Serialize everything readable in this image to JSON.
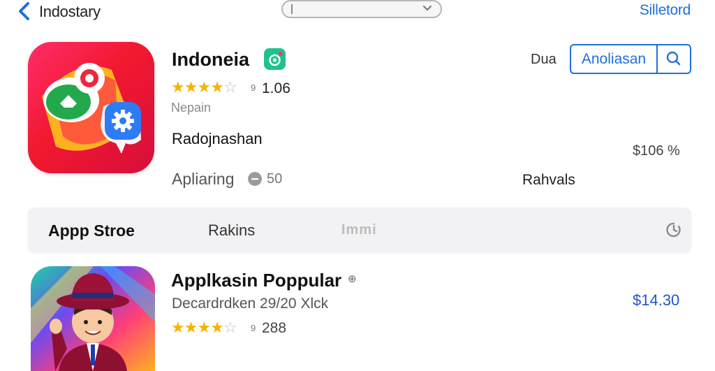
{
  "nav": {
    "back_label": "Indostary",
    "select_label": "Silletord"
  },
  "featured": {
    "title": "Indoneia",
    "rating_stars": 3.5,
    "rating_separator": "9",
    "rating_value": "1.06",
    "subtitle": "Nepain",
    "description": "Radojnashan",
    "info_label": "Apliaring",
    "info_value": "50",
    "side_label": "Dua",
    "get_button": "Anoliasan",
    "price": "$106 %",
    "reviews": "Rahvals",
    "colors": {
      "icon_bg": "#f2182f",
      "badge": "#1ec38c"
    }
  },
  "tabs": [
    {
      "label": "Appp Stroe",
      "selected": true
    },
    {
      "label": "Rakins",
      "selected": false
    },
    {
      "label": "Immi",
      "selected": false
    }
  ],
  "second_app": {
    "title": "Applkasin Poppular",
    "badge": "⊕",
    "subtitle": "Decardrdken 29/20 Xlck",
    "rating_stars": 3.5,
    "rating_separator": "9",
    "rating_value": "288",
    "price": "$14.30"
  },
  "icons": [
    "chevron-left-icon",
    "chevron-down-icon",
    "search-icon",
    "camera-icon",
    "info-icon",
    "refresh-icon",
    "gear-icon",
    "star-icon"
  ],
  "accent_color": "#1f6fe0"
}
